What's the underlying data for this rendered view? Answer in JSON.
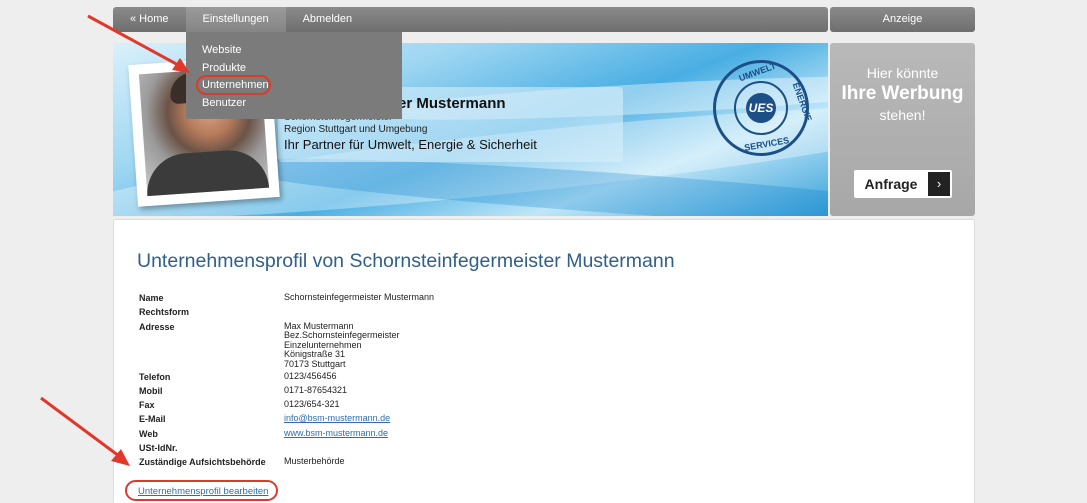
{
  "nav": {
    "items": [
      "« Home",
      "Einstellungen",
      "Abmelden"
    ],
    "right_label": "Anzeige"
  },
  "dropdown": {
    "items": [
      "Website",
      "Produkte",
      "Unternehmen",
      "Benutzer"
    ]
  },
  "banner": {
    "name_partial": "er Mustermann",
    "clipped_line": "Schornsteinfegermeister",
    "region": "Region Stuttgart und Umgebung",
    "tagline": "Ihr Partner für Umwelt, Energie & Sicherheit",
    "seal": {
      "core": "UES",
      "top": "UMWELT",
      "right": "ENERGIE",
      "bottom": "SERVICES"
    }
  },
  "ad": {
    "line1": "Hier könnte",
    "line2": "Ihre Werbung",
    "line3": "stehen!",
    "button": "Anfrage",
    "button_arrow": "›"
  },
  "profile": {
    "title": "Unternehmensprofil von Schornsteinfegermeister Mustermann",
    "rows": [
      {
        "label": "Name",
        "value": [
          "Schornsteinfegermeister Mustermann"
        ]
      },
      {
        "label": "Rechtsform",
        "value": [
          ""
        ]
      },
      {
        "label": "Adresse",
        "value": [
          "Max Mustermann",
          "Bez.Schornsteinfegermeister",
          "Einzelunternehmen",
          "Königstraße 31",
          "70173 Stuttgart"
        ]
      },
      {
        "label": "Telefon",
        "value": [
          "0123/456456"
        ]
      },
      {
        "label": "Mobil",
        "value": [
          "0171-87654321"
        ]
      },
      {
        "label": "Fax",
        "value": [
          "0123/654-321"
        ]
      },
      {
        "label": "E-Mail",
        "value": [
          "info@bsm-mustermann.de"
        ],
        "link": true
      },
      {
        "label": "Web",
        "value": [
          "www.bsm-mustermann.de"
        ],
        "link": true
      },
      {
        "label": "USt-IdNr.",
        "value": [
          ""
        ]
      },
      {
        "label": "Zuständige Aufsichtsbehörde",
        "value": [
          "Musterbehörde"
        ]
      }
    ],
    "edit_link": "Unternehmensprofil bearbeiten"
  },
  "colors": {
    "accent": "#2f5f8a",
    "highlight": "#e0392b",
    "nav": "#7b7b7b"
  }
}
